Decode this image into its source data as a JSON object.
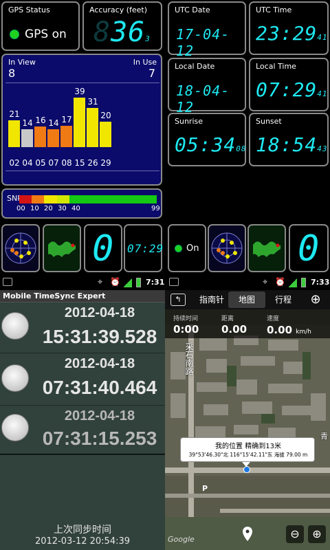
{
  "gps": {
    "status_label": "GPS Status",
    "status_value": "GPS on",
    "accuracy_label": "Accuracy (feet)",
    "accuracy_value": "36",
    "accuracy_decimal": "3",
    "accuracy_ghost": "8",
    "utc_date_label": "UTC Date",
    "utc_date_value": "17-04-12",
    "utc_time_label": "UTC Time",
    "utc_time_value": "23:29",
    "utc_time_seconds": "41",
    "local_date_label": "Local Date",
    "local_date_value": "18-04-12",
    "local_time_label": "Local Time",
    "local_time_value": "07:29",
    "local_time_seconds": "41",
    "sunrise_label": "Sunrise",
    "sunrise_value": "05:34",
    "sunrise_seconds": "08",
    "sunset_label": "Sunset",
    "sunset_value": "18:54",
    "sunset_seconds": "43",
    "in_view_label": "In View",
    "in_view_value": "8",
    "in_use_label": "In Use",
    "in_use_value": "7",
    "snr_label": "SNR",
    "snr_ticks": [
      "00",
      "10",
      "20",
      "30",
      "40",
      "99"
    ],
    "satellites": [
      {
        "prn": "02",
        "snr": "21",
        "color": "#f0e600"
      },
      {
        "prn": "04",
        "snr": "14",
        "color": "#c8c8c8"
      },
      {
        "prn": "05",
        "snr": "16",
        "color": "#f07a14"
      },
      {
        "prn": "07",
        "snr": "14",
        "color": "#f07a14"
      },
      {
        "prn": "08",
        "snr": "17",
        "color": "#f07a14"
      },
      {
        "prn": "15",
        "snr": "39",
        "color": "#f0e600"
      },
      {
        "prn": "26",
        "snr": "31",
        "color": "#f0e600"
      },
      {
        "prn": "29",
        "snr": "20",
        "color": "#f0e600"
      }
    ],
    "bottom_counter_left": "0",
    "bottom_time": "07:29",
    "bottom_on_label": "On",
    "bottom_counter_right": "0"
  },
  "statusbar_left": {
    "time": "7:31"
  },
  "statusbar_right": {
    "time": "7:33"
  },
  "timesync": {
    "title": "Mobile TimeSync Expert",
    "rows": [
      {
        "date": "2012-04-18",
        "time": "15:31:39.528"
      },
      {
        "date": "2012-04-18",
        "time": "07:31:40.464"
      },
      {
        "date": "2012-04-18",
        "time": "07:31:15.253"
      }
    ],
    "last_sync_label": "上次同步时间",
    "last_sync_value": "2012-03-12 20:54:39"
  },
  "map": {
    "tabs": [
      "指南针",
      "地图",
      "行程"
    ],
    "duration_label": "持续时间",
    "duration_value": "0:00",
    "distance_label": "距离",
    "distance_value": "0.00",
    "speed_label": "速度",
    "speed_value": "0.00",
    "speed_unit": "km/h",
    "road_label": "采石南路",
    "road_label_right": "青",
    "popup_title": "我的位置 精确到13米",
    "popup_detail": "39°53'46.30\"北 116°15'42.11\"东 海拔 79.00 m",
    "parking": "P",
    "google": "Google"
  }
}
